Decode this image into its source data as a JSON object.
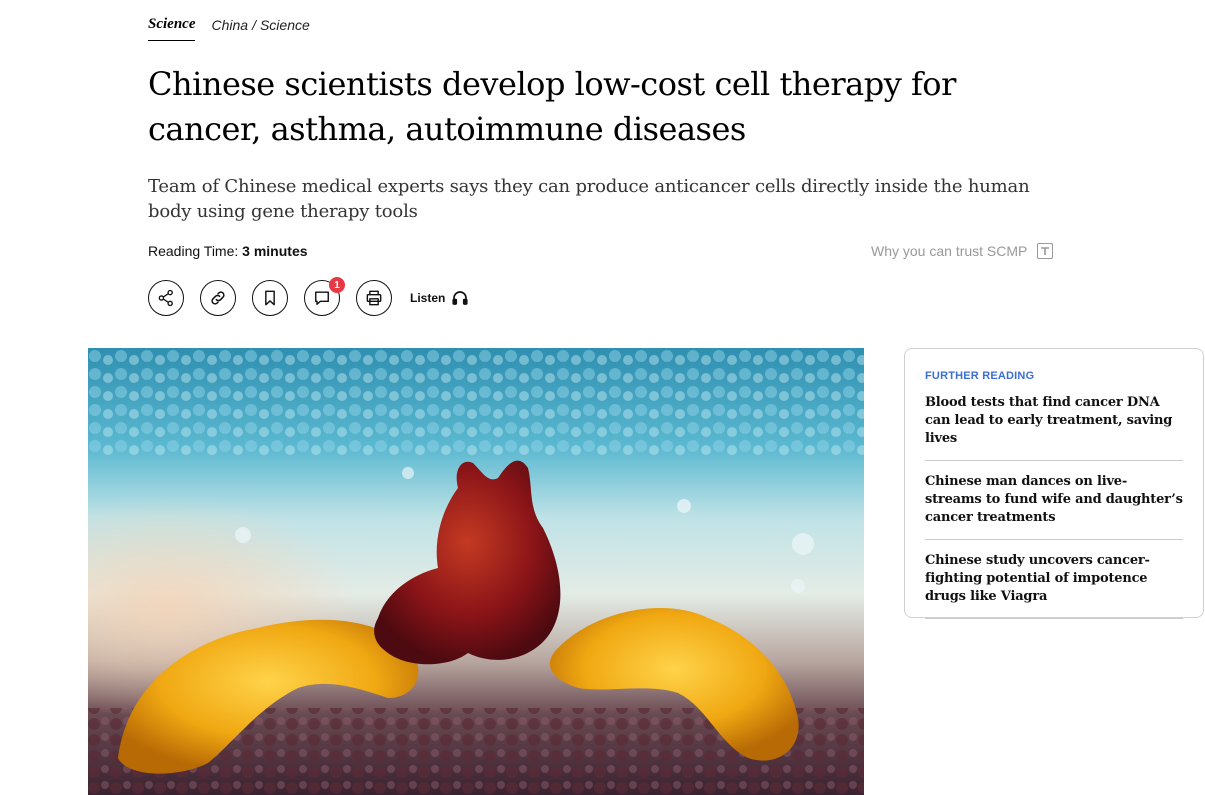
{
  "breadcrumb": {
    "primary": "Science",
    "secondary": [
      "China",
      "Science"
    ],
    "separator": "/"
  },
  "article": {
    "headline": "Chinese scientists develop low-cost cell therapy for cancer, asthma, autoimmune diseases",
    "subheadline": "Team of Chinese medical experts says they can produce anticancer cells directly inside the human body using gene therapy tools",
    "reading_time_label": "Reading Time:",
    "reading_time_value": "3 minutes",
    "trust_link": "Why you can trust SCMP"
  },
  "actions": {
    "share_icon": "share-icon",
    "link_icon": "link-icon",
    "bookmark_icon": "bookmark-icon",
    "comment_icon": "comment-icon",
    "comment_count": "1",
    "print_icon": "print-icon",
    "listen_label": "Listen",
    "listen_icon": "headphones-icon"
  },
  "further_reading": {
    "label": "FURTHER READING",
    "items": [
      "Blood tests that find cancer DNA can lead to early treatment, saving lives",
      "Chinese man dances on live-streams to fund wife and daughter’s cancer treatments",
      "Chinese study uncovers cancer-fighting potential of impotence drugs like Viagra"
    ]
  },
  "colors": {
    "accent_blue": "#3b6fd8",
    "badge_red": "#e63946",
    "muted_text": "#999999"
  }
}
